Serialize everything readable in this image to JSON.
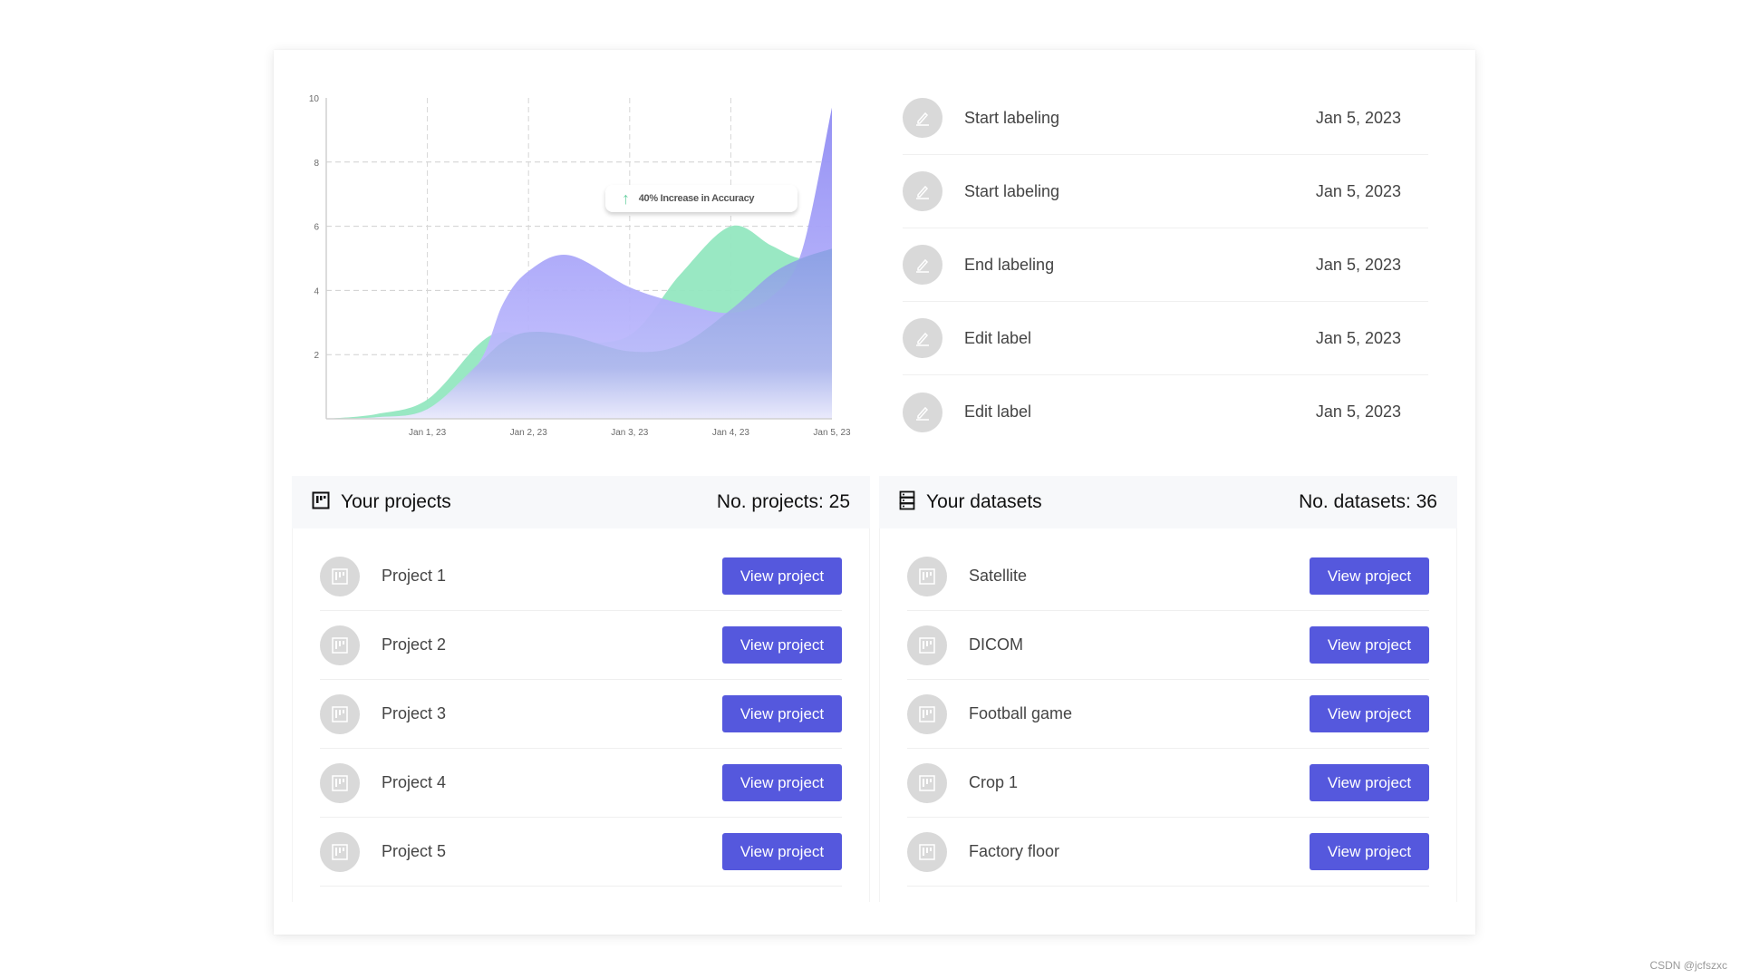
{
  "chart_data": {
    "type": "area",
    "title": "",
    "xlabel": "",
    "ylabel": "",
    "ylim": [
      0,
      10
    ],
    "yticks": [
      "2",
      "4",
      "6",
      "8",
      "10"
    ],
    "ytick_values": [
      2,
      4,
      6,
      8,
      10
    ],
    "categories": [
      "Jan 1, 23",
      "Jan 2, 23",
      "Jan 3, 23",
      "Jan 4, 23",
      "Jan 5, 23"
    ],
    "x": [
      0,
      0.5,
      1,
      1.5,
      1.75,
      2,
      2.4,
      3,
      3.5,
      4,
      4.4,
      4.7,
      5
    ],
    "grid": true,
    "series": [
      {
        "name": "green",
        "color": "#8fe6bd",
        "values": [
          0,
          0.15,
          0.6,
          2.3,
          2.7,
          2.5,
          2.4,
          2.6,
          4.5,
          6.0,
          5.4,
          5.0,
          5.3
        ]
      },
      {
        "name": "purple",
        "color": "#9a96f5",
        "values": [
          0,
          0.05,
          0.3,
          1.7,
          3.6,
          4.6,
          5.1,
          4.1,
          3.6,
          3.3,
          3.8,
          5.2,
          9.7
        ]
      },
      {
        "name": "blue",
        "color": "#8fa5e6",
        "values": [
          0,
          0.05,
          0.3,
          1.7,
          2.4,
          2.7,
          2.6,
          2.1,
          2.3,
          3.4,
          4.5,
          5.0,
          5.3
        ]
      }
    ],
    "annotation": "40% Increase in Accuracy"
  },
  "tooltip": {
    "icon": "arrow-up-icon",
    "text": "40% Increase in Accuracy"
  },
  "activity": [
    {
      "title": "Start labeling",
      "date": "Jan 5, 2023",
      "icon": "pencil-icon"
    },
    {
      "title": "Start labeling",
      "date": "Jan 5, 2023",
      "icon": "pencil-icon"
    },
    {
      "title": "End labeling",
      "date": "Jan 5, 2023",
      "icon": "pencil-icon"
    },
    {
      "title": "Edit label",
      "date": "Jan 5, 2023",
      "icon": "pencil-icon"
    },
    {
      "title": "Edit label",
      "date": "Jan 5, 2023",
      "icon": "pencil-icon"
    }
  ],
  "projects": {
    "title": "Your projects",
    "count_label": "No. projects: 25",
    "items": [
      {
        "name": "Project 1",
        "button": "View project"
      },
      {
        "name": "Project 2",
        "button": "View project"
      },
      {
        "name": "Project 3",
        "button": "View project"
      },
      {
        "name": "Project 4",
        "button": "View project"
      },
      {
        "name": "Project 5",
        "button": "View project"
      }
    ]
  },
  "datasets": {
    "title": "Your datasets",
    "count_label": "No. datasets: 36",
    "items": [
      {
        "name": "Satellite",
        "button": "View project"
      },
      {
        "name": "DICOM",
        "button": "View project"
      },
      {
        "name": "Football game",
        "button": "View project"
      },
      {
        "name": "Crop 1",
        "button": "View project"
      },
      {
        "name": "Factory floor",
        "button": "View project"
      }
    ]
  },
  "colors": {
    "accent": "#5558dd",
    "green": "#8fe6bd",
    "purple": "#9a96f5"
  },
  "watermark": "CSDN @jcfszxc"
}
